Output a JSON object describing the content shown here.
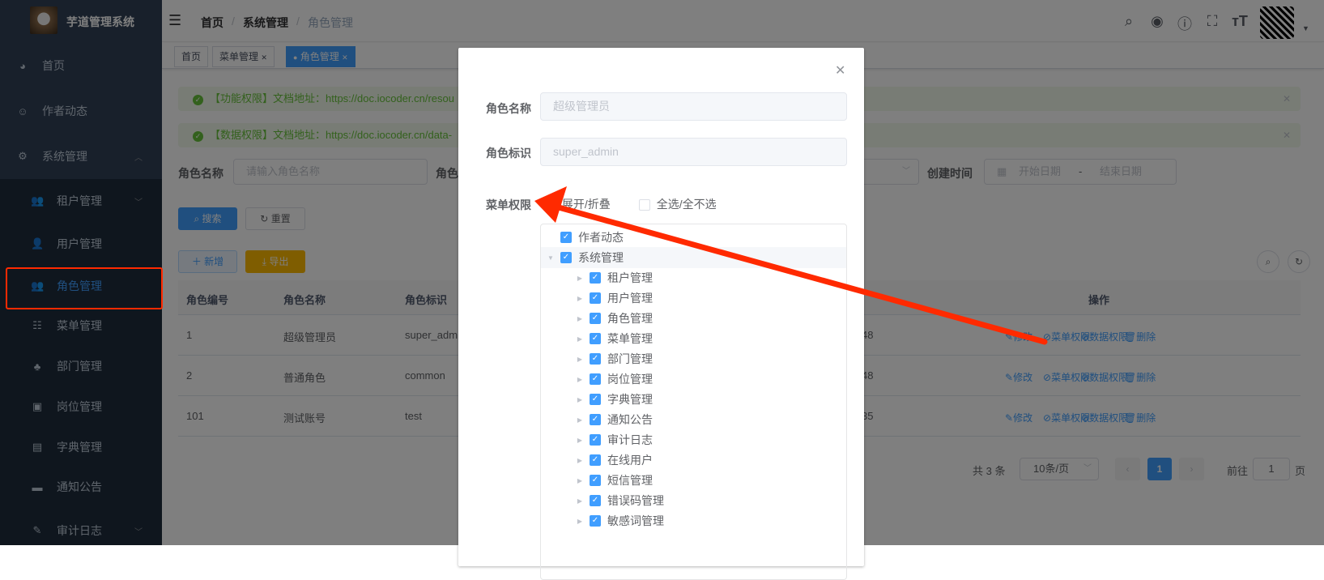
{
  "app": {
    "title": "芋道管理系统"
  },
  "sidebar": {
    "items": [
      {
        "label": "首页",
        "icon": "dashboard-icon"
      },
      {
        "label": "作者动态",
        "icon": "robot-icon"
      },
      {
        "label": "系统管理",
        "icon": "gear-icon"
      },
      {
        "label": "租户管理",
        "icon": "peoples-icon"
      },
      {
        "label": "用户管理",
        "icon": "user-icon"
      },
      {
        "label": "角色管理",
        "icon": "peoples-icon",
        "active": true
      },
      {
        "label": "菜单管理",
        "icon": "tree-table-icon"
      },
      {
        "label": "部门管理",
        "icon": "tree-icon"
      },
      {
        "label": "岗位管理",
        "icon": "post-icon"
      },
      {
        "label": "字典管理",
        "icon": "dict-icon"
      },
      {
        "label": "通知公告",
        "icon": "message-icon"
      },
      {
        "label": "审计日志",
        "icon": "log-icon"
      }
    ]
  },
  "header": {
    "breadcrumb": [
      "首页",
      "系统管理",
      "角色管理"
    ]
  },
  "tags": [
    {
      "label": "首页"
    },
    {
      "label": "菜单管理"
    },
    {
      "label": "角色管理",
      "active": true
    }
  ],
  "alerts": [
    "【功能权限】文档地址：https://doc.iocoder.cn/resou",
    "【数据权限】文档地址：https://doc.iocoder.cn/data-"
  ],
  "search": {
    "name_label": "角色名称",
    "name_placeholder": "请输入角色名称",
    "code_label": "角色",
    "created_label": "创建时间",
    "start_placeholder": "开始日期",
    "sep": "-",
    "end_placeholder": "结束日期",
    "search_btn": "搜索",
    "reset_btn": "重置",
    "add_btn": "新增",
    "export_btn": "导出"
  },
  "table": {
    "headers": [
      "角色编号",
      "角色名称",
      "角色标识",
      "操作"
    ],
    "rows": [
      {
        "id": "1",
        "name": "超级管理员",
        "code": "super_adm",
        "time": "48"
      },
      {
        "id": "2",
        "name": "普通角色",
        "code": "common",
        "time": "48"
      },
      {
        "id": "101",
        "name": "测试账号",
        "code": "test",
        "time": "35"
      }
    ],
    "actions": [
      "修改",
      "菜单权限",
      "数据权限",
      "删除"
    ]
  },
  "pagination": {
    "total": "共 3 条",
    "page_size": "10条/页",
    "current": "1",
    "goto_label": "前往",
    "goto_value": "1",
    "page_suffix": "页"
  },
  "dialog": {
    "name_label": "角色名称",
    "name_value": "超级管理员",
    "code_label": "角色标识",
    "code_value": "super_admin",
    "menu_label": "菜单权限",
    "expand_label": "展开/折叠",
    "select_all_label": "全选/全不选",
    "tree": [
      {
        "label": "作者动态",
        "level": 0,
        "checked": true
      },
      {
        "label": "系统管理",
        "level": 0,
        "checked": true,
        "expanded": true
      },
      {
        "label": "租户管理",
        "level": 1,
        "checked": true
      },
      {
        "label": "用户管理",
        "level": 1,
        "checked": true
      },
      {
        "label": "角色管理",
        "level": 1,
        "checked": true
      },
      {
        "label": "菜单管理",
        "level": 1,
        "checked": true
      },
      {
        "label": "部门管理",
        "level": 1,
        "checked": true
      },
      {
        "label": "岗位管理",
        "level": 1,
        "checked": true
      },
      {
        "label": "字典管理",
        "level": 1,
        "checked": true
      },
      {
        "label": "通知公告",
        "level": 1,
        "checked": true
      },
      {
        "label": "审计日志",
        "level": 1,
        "checked": true
      },
      {
        "label": "在线用户",
        "level": 1,
        "checked": true
      },
      {
        "label": "短信管理",
        "level": 1,
        "checked": true
      },
      {
        "label": "错误码管理",
        "level": 1,
        "checked": true
      },
      {
        "label": "敏感词管理",
        "level": 1,
        "checked": true
      }
    ]
  },
  "colors": {
    "primary": "#409eff",
    "sidebar": "#304156",
    "success": "#67c23a",
    "warning": "#ffba00",
    "annotation": "#ff2a00"
  }
}
